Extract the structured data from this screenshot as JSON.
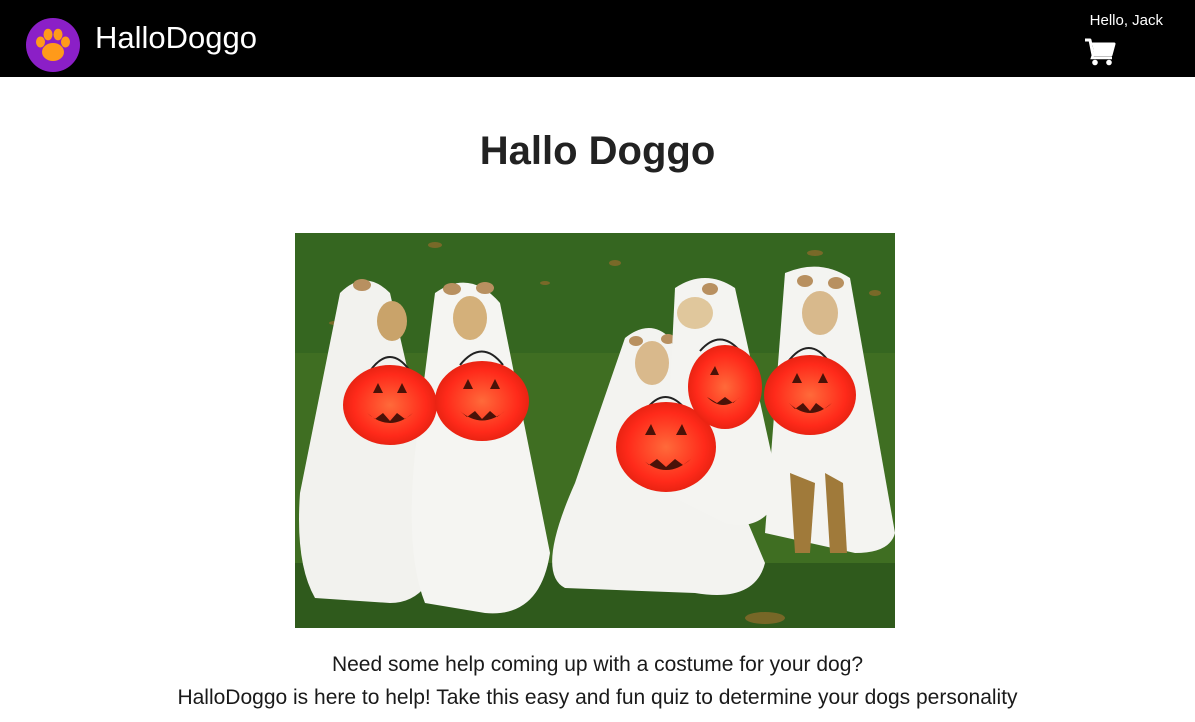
{
  "header": {
    "brand": "HalloDoggo",
    "greeting": "Hello, Jack",
    "logo_icon": "paw-icon",
    "cart_icon": "shopping-cart-icon"
  },
  "main": {
    "title": "Hallo Doggo",
    "hero_image": "dogs-in-ghost-costumes-with-pumpkin-buckets",
    "intro_line1": "Need some help coming up with a costume for your dog?",
    "intro_line2": "HalloDoggo is here to help! Take this easy and fun quiz to determine your dogs personality"
  },
  "colors": {
    "navbar": "#000000",
    "logo_circle": "#8b1fc7",
    "paw": "#ff9a1a",
    "heading": "#222222"
  }
}
